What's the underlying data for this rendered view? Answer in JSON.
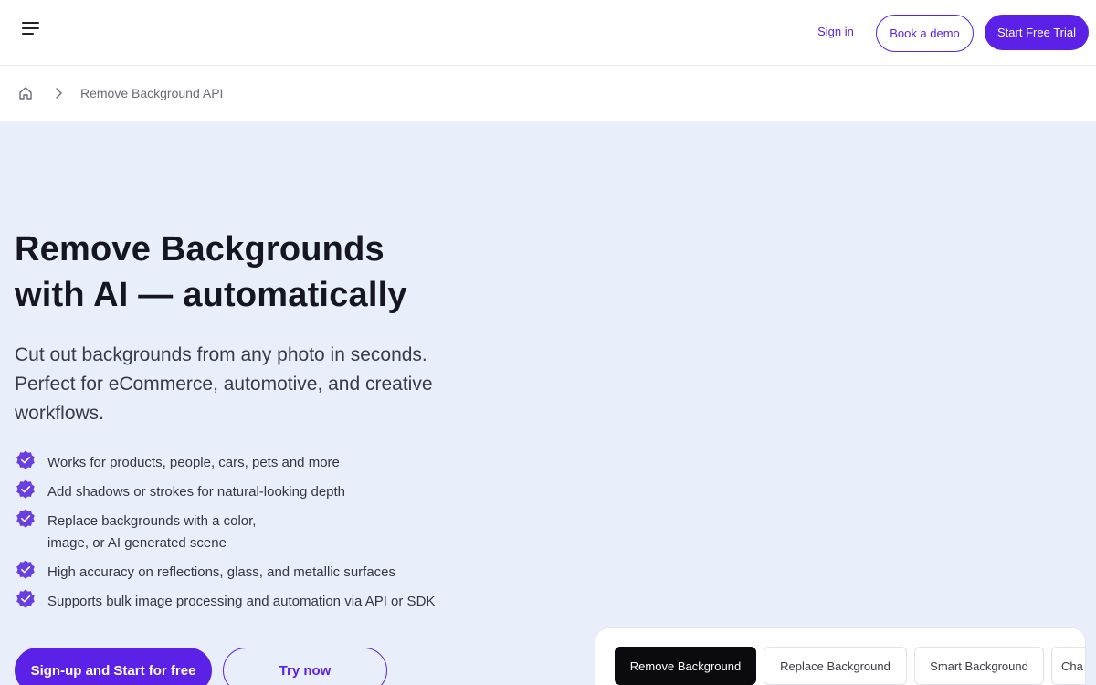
{
  "header": {
    "signin_label": "Sign in",
    "demo_label": "Book a demo",
    "trial_label": "Start Free Trial"
  },
  "breadcrumb": {
    "current": "Remove Background API"
  },
  "hero": {
    "title_line1": "Remove Backgrounds",
    "title_line2": "with AI — automatically",
    "subtitle": "Cut out backgrounds from any photo in seconds. Perfect for eCommerce, automotive, and creative workflows.",
    "features": [
      {
        "line1": "Works for products, people, cars, pets and more"
      },
      {
        "line1": "Add shadows or strokes for natural-looking depth"
      },
      {
        "line1": "Replace backgrounds with a color,",
        "line2": "image, or AI generated scene"
      },
      {
        "line1": "High accuracy on reflections, glass, and metallic surfaces"
      },
      {
        "line1": "Supports bulk image processing and automation via API or SDK"
      }
    ],
    "cta_primary": "Sign-up and Start for free",
    "cta_secondary": "Try now"
  },
  "demo": {
    "tabs": [
      {
        "label": "Remove Background",
        "active": true
      },
      {
        "label": "Replace Background",
        "active": false
      },
      {
        "label": "Smart Background",
        "active": false
      },
      {
        "label": "Cha",
        "active": false
      }
    ]
  },
  "colors": {
    "accent": "#5b21e6",
    "hero_bg": "#e9eefb",
    "active_tab_bg": "#0b0b0f"
  },
  "icons": [
    "menu-icon",
    "home-icon",
    "chevron-right-icon",
    "verified-check-icon"
  ]
}
